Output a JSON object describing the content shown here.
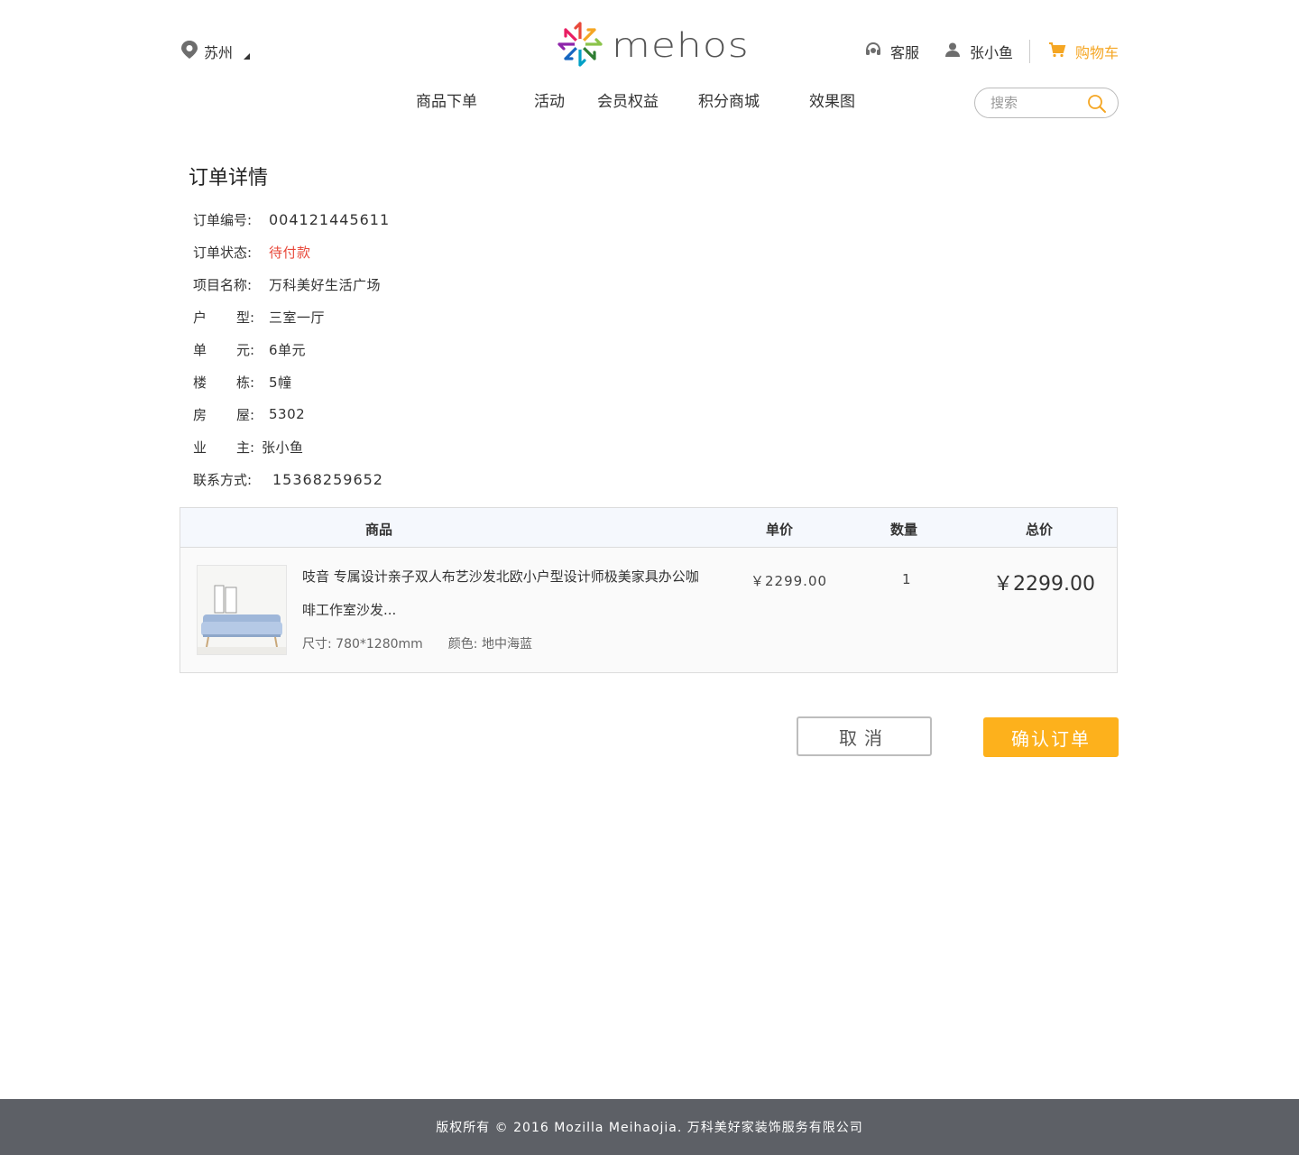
{
  "header": {
    "location": "苏州",
    "logo_text": "mehos",
    "service_label": "客服",
    "user_name": "张小鱼",
    "cart_label": "购物车",
    "accent_color": "#f5a623"
  },
  "nav": {
    "items": [
      "商品下单",
      "活动",
      "会员权益",
      "积分商城",
      "效果图"
    ]
  },
  "search": {
    "placeholder": "搜索"
  },
  "order": {
    "title": "订单详情",
    "fields": [
      {
        "label": "订单编号:",
        "value": "004121445611"
      },
      {
        "label": "订单状态:",
        "value": "待付款",
        "status_color": "#e8483a"
      },
      {
        "label": "项目名称:",
        "value": "万科美好生活广场"
      },
      {
        "label": [
          "户",
          "型:"
        ],
        "value": "三室一厅"
      },
      {
        "label": [
          "单",
          "元:"
        ],
        "value": "6单元"
      },
      {
        "label": [
          "楼",
          "栋:"
        ],
        "value": "5幢"
      },
      {
        "label": [
          "房",
          "屋:"
        ],
        "value": "5302"
      },
      {
        "label": [
          "业",
          "主:"
        ],
        "value": "张小鱼"
      },
      {
        "label": "联系方式:",
        "value": "15368259652"
      }
    ]
  },
  "table": {
    "headers": [
      "商品",
      "单价",
      "数量",
      "总价"
    ],
    "rows": [
      {
        "name": "吱音 专属设计亲子双人布艺沙发北欧小户型设计师极美家具办公咖啡工作室沙发...",
        "size": "尺寸: 780*1280mm",
        "color": "颜色: 地中海蓝",
        "unit_price": "￥2299.00",
        "quantity": "1",
        "total": "￥2299.00"
      }
    ]
  },
  "actions": {
    "cancel": "取消",
    "confirm": "确认订单",
    "confirm_color": "#fdb11c"
  },
  "footer": {
    "copyright": "版权所有 © 2016 Mozilla Meihaojia. 万科美好家装饰服务有限公司"
  }
}
